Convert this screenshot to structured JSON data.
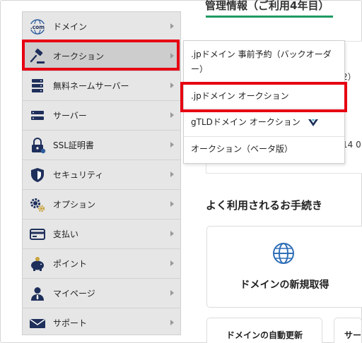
{
  "page": {
    "heading": "管理情報（ご利用4年目）",
    "fragment_paren": "2）",
    "fragment_date": "14 0",
    "section_title": "よく利用されるお手続き",
    "tile_label": "ドメインの新規取得",
    "bottom_button_1": "ドメインの自動更新",
    "bottom_button_2": "サー"
  },
  "sidebar": {
    "items": [
      {
        "label": "ドメイン",
        "icon": "dotcom-icon"
      },
      {
        "label": "オークション",
        "icon": "gavel-icon"
      },
      {
        "label": "無料ネームサーバー",
        "icon": "server-stack-icon"
      },
      {
        "label": "サーバー",
        "icon": "server-icon"
      },
      {
        "label": "SSL証明書",
        "icon": "lock-icon"
      },
      {
        "label": "セキュリティ",
        "icon": "shield-icon"
      },
      {
        "label": "オプション",
        "icon": "gears-icon"
      },
      {
        "label": "支払い",
        "icon": "card-icon"
      },
      {
        "label": "ポイント",
        "icon": "piggy-bank-icon"
      },
      {
        "label": "マイページ",
        "icon": "user-icon"
      },
      {
        "label": "サポート",
        "icon": "mail-icon"
      }
    ],
    "dotcom_text": ".com"
  },
  "dropdown": {
    "items": [
      {
        "label": ".jpドメイン 事前予約（バックオーダー）"
      },
      {
        "label": ".jpドメイン オークション"
      },
      {
        "label": "gTLDドメイン オークション"
      },
      {
        "label": "オークション（ベータ版）"
      }
    ]
  },
  "colors": {
    "highlight": "#e60012",
    "accent_green": "#1f9b63",
    "icon_navy": "#1e2f5b",
    "icon_blue": "#2f5e9e"
  }
}
